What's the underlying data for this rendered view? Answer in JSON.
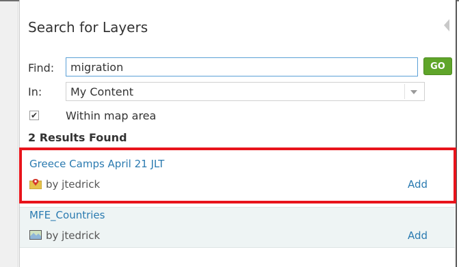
{
  "panel": {
    "title": "Search for Layers"
  },
  "search": {
    "find_label": "Find:",
    "find_value": "migration",
    "go_label": "GO",
    "in_label": "In:",
    "in_value": "My Content",
    "within_map_label": "Within map area",
    "within_map_checked": true
  },
  "results": {
    "count_label": "2 Results Found",
    "items": [
      {
        "title": "Greece Camps April 21 JLT",
        "owner": "by jtedrick",
        "add_label": "Add",
        "icon": "map-pin-icon"
      },
      {
        "title": "MFE_Countries",
        "owner": "by jtedrick",
        "add_label": "Add",
        "icon": "map-layer-icon"
      }
    ]
  },
  "colors": {
    "accent_link": "#2a7ab0",
    "go_button": "#5fa52a",
    "highlight": "#e8141b"
  }
}
